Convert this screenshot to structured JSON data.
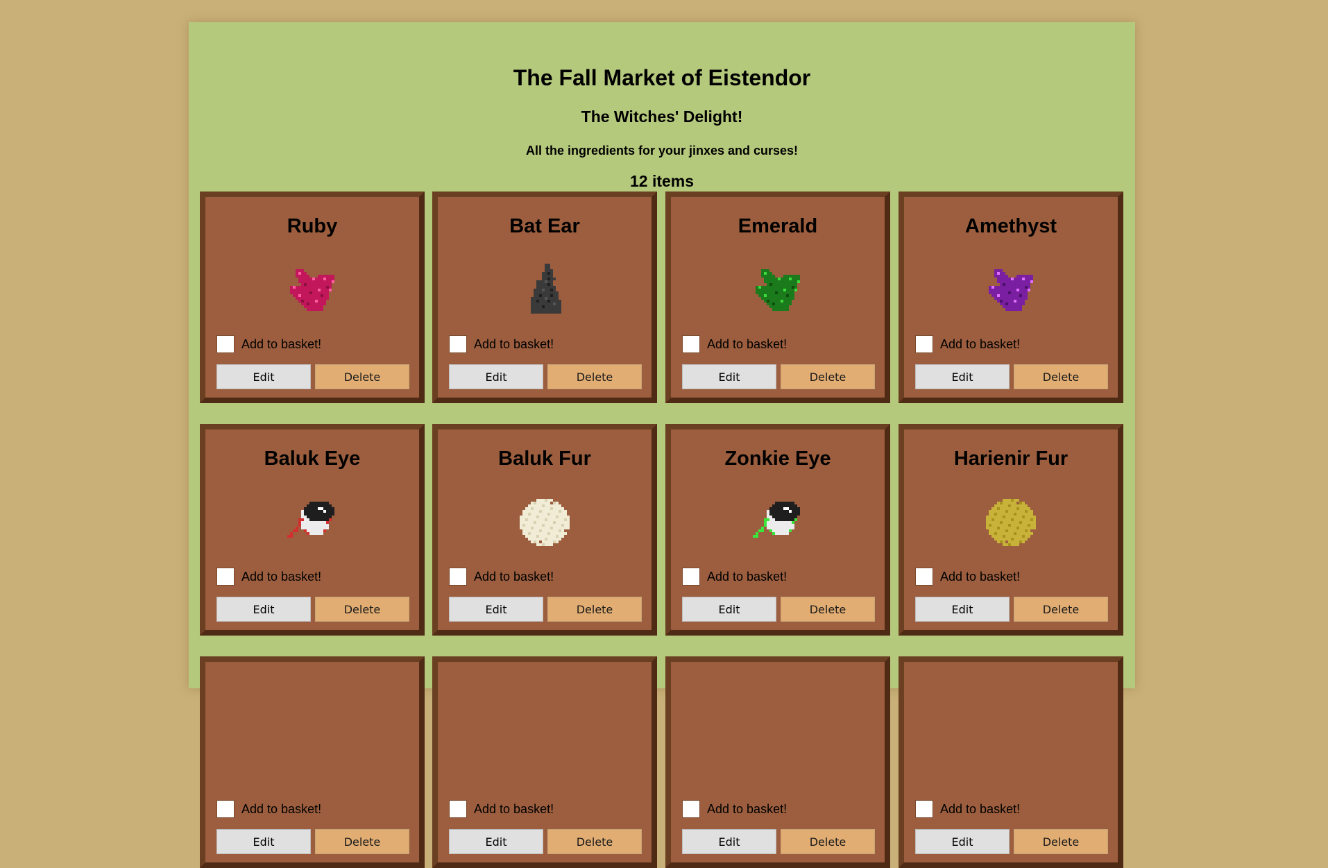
{
  "header": {
    "title": "The Fall Market of Eistendor",
    "subtitle": "The Witches' Delight!",
    "tagline": "All the ingredients for your jinxes and curses!",
    "count": "12 items"
  },
  "card_labels": {
    "basket": "Add to basket!",
    "edit": "Edit",
    "delete": "Delete"
  },
  "items": [
    {
      "name": "Ruby",
      "icon": "ruby-gem-icon",
      "color": "#c2185b"
    },
    {
      "name": "Bat Ear",
      "icon": "bat-ear-icon",
      "color": "#3b3b3b"
    },
    {
      "name": "Emerald",
      "icon": "emerald-gem-icon",
      "color": "#1b7a1b"
    },
    {
      "name": "Amethyst",
      "icon": "amethyst-gem-icon",
      "color": "#7b1fa2"
    },
    {
      "name": "Baluk Eye",
      "icon": "baluk-eye-icon",
      "color": "#d32f2f"
    },
    {
      "name": "Baluk Fur",
      "icon": "baluk-fur-icon",
      "color": "#f0ecd6"
    },
    {
      "name": "Zonkie Eye",
      "icon": "zonkie-eye-icon",
      "color": "#39e639"
    },
    {
      "name": "Harienir Fur",
      "icon": "harienir-fur-icon",
      "color": "#c9b23a"
    },
    {
      "name": "",
      "icon": "",
      "color": ""
    },
    {
      "name": "",
      "icon": "",
      "color": ""
    },
    {
      "name": "",
      "icon": "",
      "color": ""
    },
    {
      "name": "",
      "icon": "",
      "color": ""
    }
  ]
}
